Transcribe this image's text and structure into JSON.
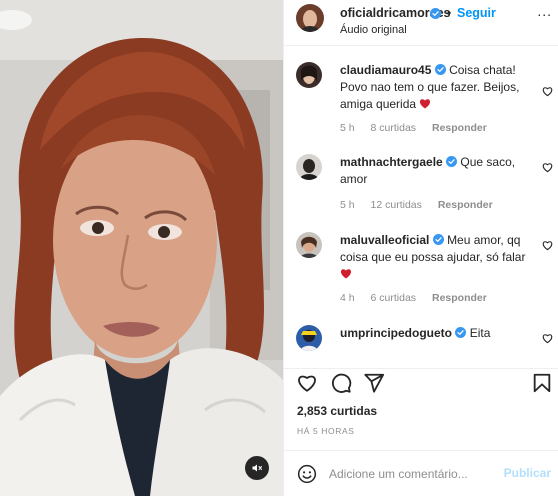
{
  "post": {
    "author": "oficialdricamoraes",
    "separator": "•",
    "follow_label": "Seguir",
    "audio_label": "Áudio original",
    "more_label": "...",
    "likes_text": "2,853 curtidas",
    "time_ago": "HÁ 5 HORAS"
  },
  "comments": [
    {
      "username": "claudiamauro45",
      "text": "Coisa chata! Povo nao tem o que fazer. Beijos, amiga querida",
      "has_heart": true,
      "age": "5 h",
      "likes": "8 curtidas",
      "reply": "Responder"
    },
    {
      "username": "mathnachtergaele",
      "text": "Que saco, amor",
      "has_heart": false,
      "age": "5 h",
      "likes": "12 curtidas",
      "reply": "Responder"
    },
    {
      "username": "maluvalleoficial",
      "text": "Meu amor, qq coisa que eu possa ajudar, só falar",
      "has_heart": true,
      "age": "4 h",
      "likes": "6 curtidas",
      "reply": "Responder"
    },
    {
      "username": "umprincipedogueto",
      "text": "Eita",
      "has_heart": false
    }
  ],
  "add_comment": {
    "placeholder": "Adicione um comentário...",
    "publish_label": "Publicar"
  },
  "icons": {
    "verified": "verified-badge-icon",
    "like": "heart-icon",
    "comment": "comment-icon",
    "share": "paper-plane-icon",
    "save": "bookmark-icon",
    "emoji": "smiley-icon",
    "mute": "speaker-muted-icon"
  },
  "colors": {
    "accent": "#0095f6",
    "verified": "#3897f0",
    "heart": "#ed4956",
    "muted_text": "#8e8e8e",
    "publish_disabled": "#b2dffc"
  }
}
